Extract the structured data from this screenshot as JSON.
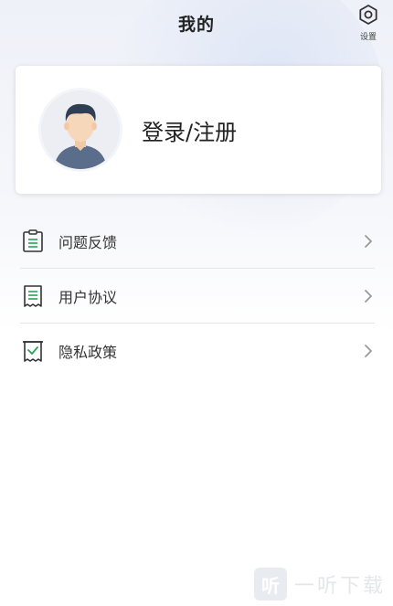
{
  "header": {
    "title": "我的",
    "settings_label": "设置",
    "settings_icon": "gear-icon"
  },
  "profile": {
    "login_label": "登录/注册",
    "avatar_icon": "default-avatar-icon"
  },
  "menu": {
    "items": [
      {
        "label": "问题反馈",
        "icon": "clipboard-feedback-icon"
      },
      {
        "label": "用户协议",
        "icon": "document-agreement-icon"
      },
      {
        "label": "隐私政策",
        "icon": "privacy-check-icon"
      }
    ]
  },
  "watermark": {
    "logo_glyph": "听",
    "text": "一听下载"
  },
  "colors": {
    "accent_green": "#2aa35a",
    "icon_dark": "#333333",
    "divider": "#e6e6e6"
  }
}
